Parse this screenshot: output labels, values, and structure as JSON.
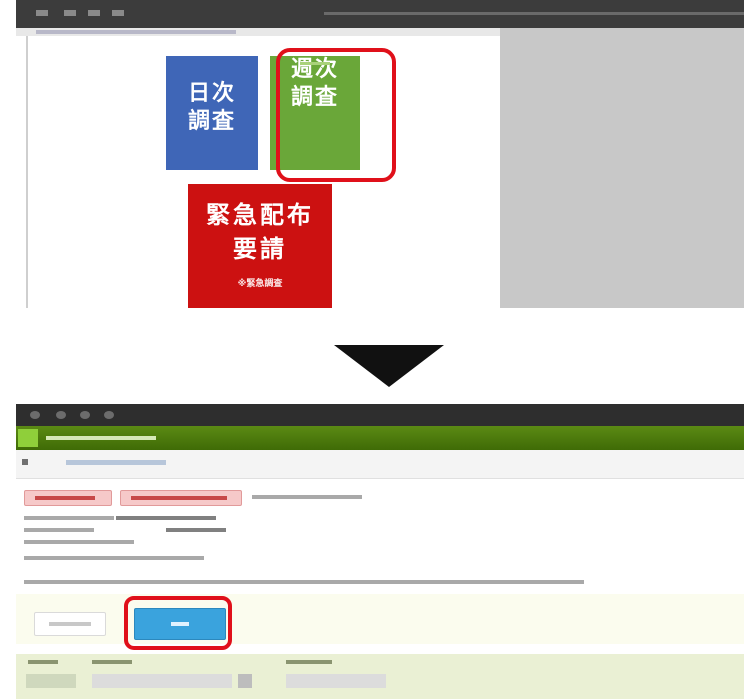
{
  "top": {
    "tiles": [
      {
        "line1": "日次",
        "line2": "調査",
        "color": "#3f66b7"
      },
      {
        "line1": "週次",
        "line2": "調査",
        "color": "#6aa739",
        "highlighted": true
      },
      {
        "line1": "緊急配布",
        "line2": "要請",
        "sub": "※緊急調査",
        "color": "#cc1111"
      }
    ]
  },
  "bottom": {
    "highlight": "search-button"
  },
  "colors": {
    "highlight": "#e0101a",
    "search_button": "#3aa3dd",
    "app_header": "#4f7d0d"
  },
  "icons": {
    "arrow": "down-triangle-arrow-icon",
    "app": "grid-app-icon"
  }
}
